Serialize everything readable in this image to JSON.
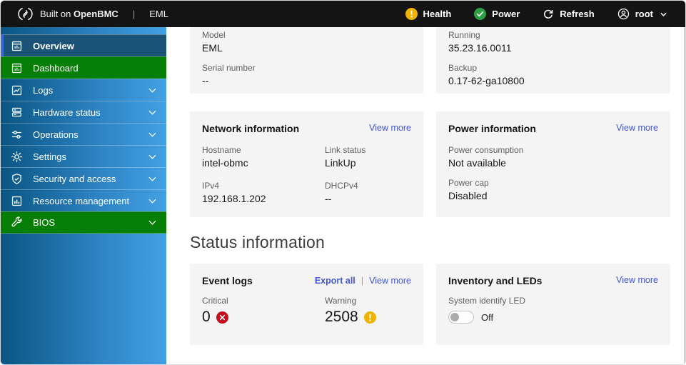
{
  "header": {
    "brand_prefix": "Built on ",
    "brand_name": "OpenBMC",
    "separator": "|",
    "app_name": "EML",
    "health_label": "Health",
    "power_label": "Power",
    "refresh_label": "Refresh",
    "user_label": "root",
    "health_icon": "warning-icon",
    "power_icon": "success-check-icon",
    "refresh_icon": "refresh-icon",
    "user_icon": "user-icon"
  },
  "sidebar": {
    "items": [
      {
        "label": "Overview",
        "icon": "overview-icon",
        "active": true,
        "expandable": false
      },
      {
        "label": "Dashboard",
        "icon": "dashboard-icon",
        "accent": "green",
        "expandable": false
      },
      {
        "label": "Logs",
        "icon": "logs-icon",
        "expandable": true
      },
      {
        "label": "Hardware status",
        "icon": "hardware-icon",
        "expandable": true
      },
      {
        "label": "Operations",
        "icon": "operations-icon",
        "expandable": true
      },
      {
        "label": "Settings",
        "icon": "settings-gear-icon",
        "expandable": true
      },
      {
        "label": "Security and access",
        "icon": "shield-icon",
        "expandable": true
      },
      {
        "label": "Resource management",
        "icon": "bar-chart-icon",
        "expandable": true
      },
      {
        "label": "BIOS",
        "icon": "wrench-icon",
        "accent": "green",
        "expandable": true
      }
    ]
  },
  "main": {
    "server_info_card": {
      "fields": [
        {
          "label": "Model",
          "value": "EML"
        },
        {
          "label": "Serial number",
          "value": "--"
        }
      ]
    },
    "firmware_card": {
      "fields": [
        {
          "label": "Running",
          "value": "35.23.16.0011"
        },
        {
          "label": "Backup",
          "value": "0.17-62-ga10800"
        }
      ]
    },
    "network_card": {
      "title": "Network information",
      "view_more": "View more",
      "fields": [
        {
          "label": "Hostname",
          "value": "intel-obmc"
        },
        {
          "label": "Link status",
          "value": "LinkUp"
        },
        {
          "label": "IPv4",
          "value": "192.168.1.202"
        },
        {
          "label": "DHCPv4",
          "value": "--"
        }
      ]
    },
    "power_card": {
      "title": "Power information",
      "view_more": "View more",
      "fields": [
        {
          "label": "Power consumption",
          "value": "Not available"
        },
        {
          "label": "Power cap",
          "value": "Disabled"
        }
      ]
    },
    "status_section_title": "Status information",
    "event_logs_card": {
      "title": "Event logs",
      "export_all": "Export all",
      "separator": "|",
      "view_more": "View more",
      "critical_label": "Critical",
      "critical_count": "0",
      "critical_icon": "error-badge-icon",
      "warning_label": "Warning",
      "warning_count": "2508",
      "warning_icon": "warning-badge-icon"
    },
    "inventory_card": {
      "title": "Inventory and LEDs",
      "view_more": "View more",
      "led_label": "System identify LED",
      "led_state": "Off"
    }
  },
  "colors": {
    "header_bg": "#141414",
    "sidebar_gradient_start": "#0a5583",
    "sidebar_gradient_end": "#42a0e2",
    "active_item_bg": "#1b5478",
    "active_item_accent": "#3a6bd6",
    "green_accent": "#077f07",
    "link_blue": "#4356d6",
    "warning_yellow": "#f0b400",
    "success_green": "#2e9e44",
    "error_red": "#c50f1f",
    "card_bg": "#f4f4f4"
  }
}
